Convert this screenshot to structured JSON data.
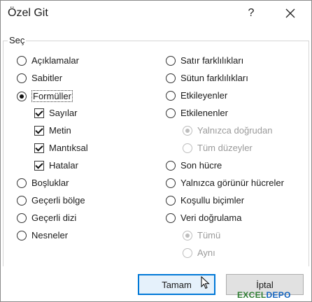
{
  "window": {
    "title": "Özel Git",
    "help_label": "?"
  },
  "group": {
    "label": "Seç"
  },
  "left_options": [
    {
      "label": "Açıklamalar",
      "checked": false
    },
    {
      "label": "Sabitler",
      "checked": false
    },
    {
      "label": "Formüller",
      "checked": true
    },
    {
      "label": "Boşluklar",
      "checked": false
    },
    {
      "label": "Geçerli bölge",
      "checked": false
    },
    {
      "label": "Geçerli dizi",
      "checked": false
    },
    {
      "label": "Nesneler",
      "checked": false
    }
  ],
  "formula_checks": [
    {
      "label": "Sayılar",
      "checked": true
    },
    {
      "label": "Metin",
      "checked": true
    },
    {
      "label": "Mantıksal",
      "checked": true
    },
    {
      "label": "Hatalar",
      "checked": true
    }
  ],
  "right_options": [
    {
      "label": "Satır farklılıkları",
      "checked": false
    },
    {
      "label": "Sütun farklılıkları",
      "checked": false
    },
    {
      "label": "Etkileyenler",
      "checked": false
    },
    {
      "label": "Etkilenenler",
      "checked": false
    },
    {
      "label": "Son hücre",
      "checked": false
    },
    {
      "label": "Yalnızca görünür hücreler",
      "checked": false
    },
    {
      "label": "Koşullu biçimler",
      "checked": false
    },
    {
      "label": "Veri doğrulama",
      "checked": false
    }
  ],
  "dependents_sub": [
    {
      "label": "Yalnızca doğrudan",
      "checked": true,
      "disabled": true
    },
    {
      "label": "Tüm düzeyler",
      "checked": false,
      "disabled": true
    }
  ],
  "validation_sub": [
    {
      "label": "Tümü",
      "checked": true,
      "disabled": true
    },
    {
      "label": "Aynı",
      "checked": false,
      "disabled": true
    }
  ],
  "buttons": {
    "ok": "Tamam",
    "cancel": "İptal"
  },
  "watermark": {
    "part1": "EXCEL",
    "part2": "DEPO"
  },
  "colors": {
    "accent": "#0078d7",
    "watermark_green": "#2e7d32",
    "watermark_blue": "#1565c0"
  }
}
